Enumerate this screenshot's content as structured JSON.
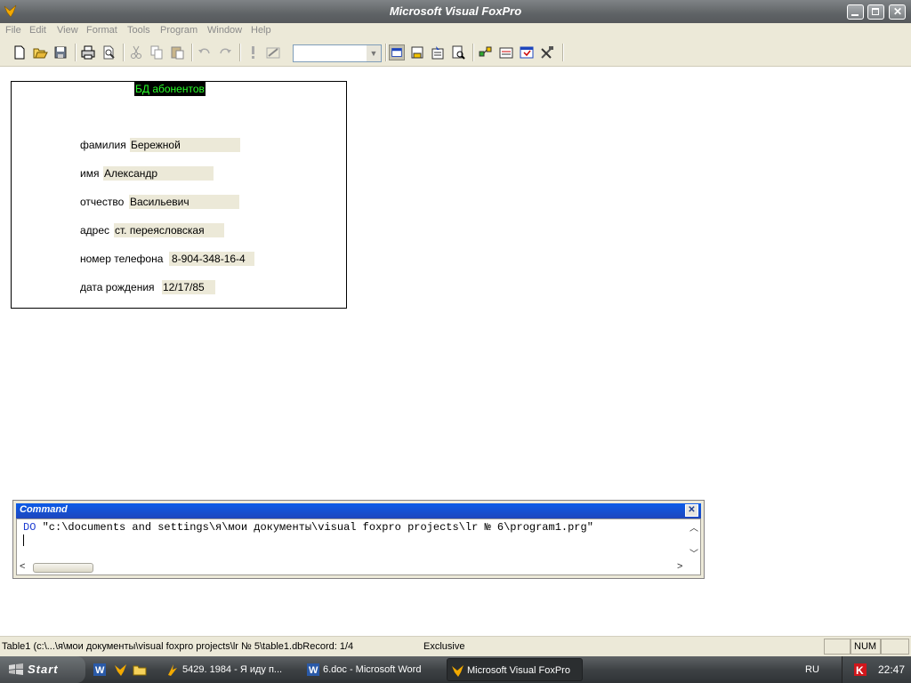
{
  "window": {
    "title": "Microsoft Visual FoxPro",
    "icon": "foxpro-icon",
    "controls": [
      "minimize-icon",
      "maximize-icon",
      "close-icon"
    ]
  },
  "menu": {
    "items": [
      "File",
      "Edit",
      "View",
      "Format",
      "Tools",
      "Program",
      "Window",
      "Help"
    ]
  },
  "toolbar": {
    "buttons": [
      "new-icon",
      "open-icon",
      "save-icon",
      "print-icon",
      "print-preview-icon",
      "cut-icon",
      "copy-icon",
      "paste-icon",
      "undo-icon",
      "redo-icon",
      "run-icon",
      "modify-form-icon",
      "command-window-icon",
      "data-session-icon",
      "properties-icon",
      "code-icon",
      "form-wizard-icon",
      "report-wizard-icon",
      "form-designer-icon",
      "build-icon"
    ],
    "combo_value": ""
  },
  "form": {
    "title": "БД абонентов",
    "fields": [
      {
        "label": "фамилия",
        "value": "Бережной"
      },
      {
        "label": "имя",
        "value": "Александр"
      },
      {
        "label": "отчество",
        "value": "Васильевич"
      },
      {
        "label": "адрес",
        "value": "ст. переясловская"
      },
      {
        "label": "номер телефона",
        "value": "8-904-348-16-4"
      },
      {
        "label": "дата рождения",
        "value": "12/17/85"
      }
    ],
    "colors": {
      "title_bg": "#000000",
      "title_fg": "#27ff27",
      "field_bg": "#ece9d8"
    }
  },
  "command_window": {
    "title": "Command",
    "keyword": "DO",
    "text": " \"c:\\documents and settings\\я\\мои документы\\visual foxpro projects\\lr № 6\\program1.prg\""
  },
  "statusbar": {
    "left": "Table1 (c:\\...\\я\\мои документы\\visual foxpro projects\\lr № 5\\table1.dbRecord: 1/4",
    "mode": "Exclusive",
    "num": "NUM"
  },
  "taskbar": {
    "start": "Start",
    "tasks": [
      {
        "label": "5429. 1984 - Я иду п...",
        "icon": "winamp-icon"
      },
      {
        "label": "6.doc - Microsoft Word",
        "icon": "word-icon"
      },
      {
        "label": "Microsoft Visual FoxPro",
        "icon": "foxpro-icon"
      }
    ],
    "lang": "RU",
    "clock": "22:47"
  }
}
